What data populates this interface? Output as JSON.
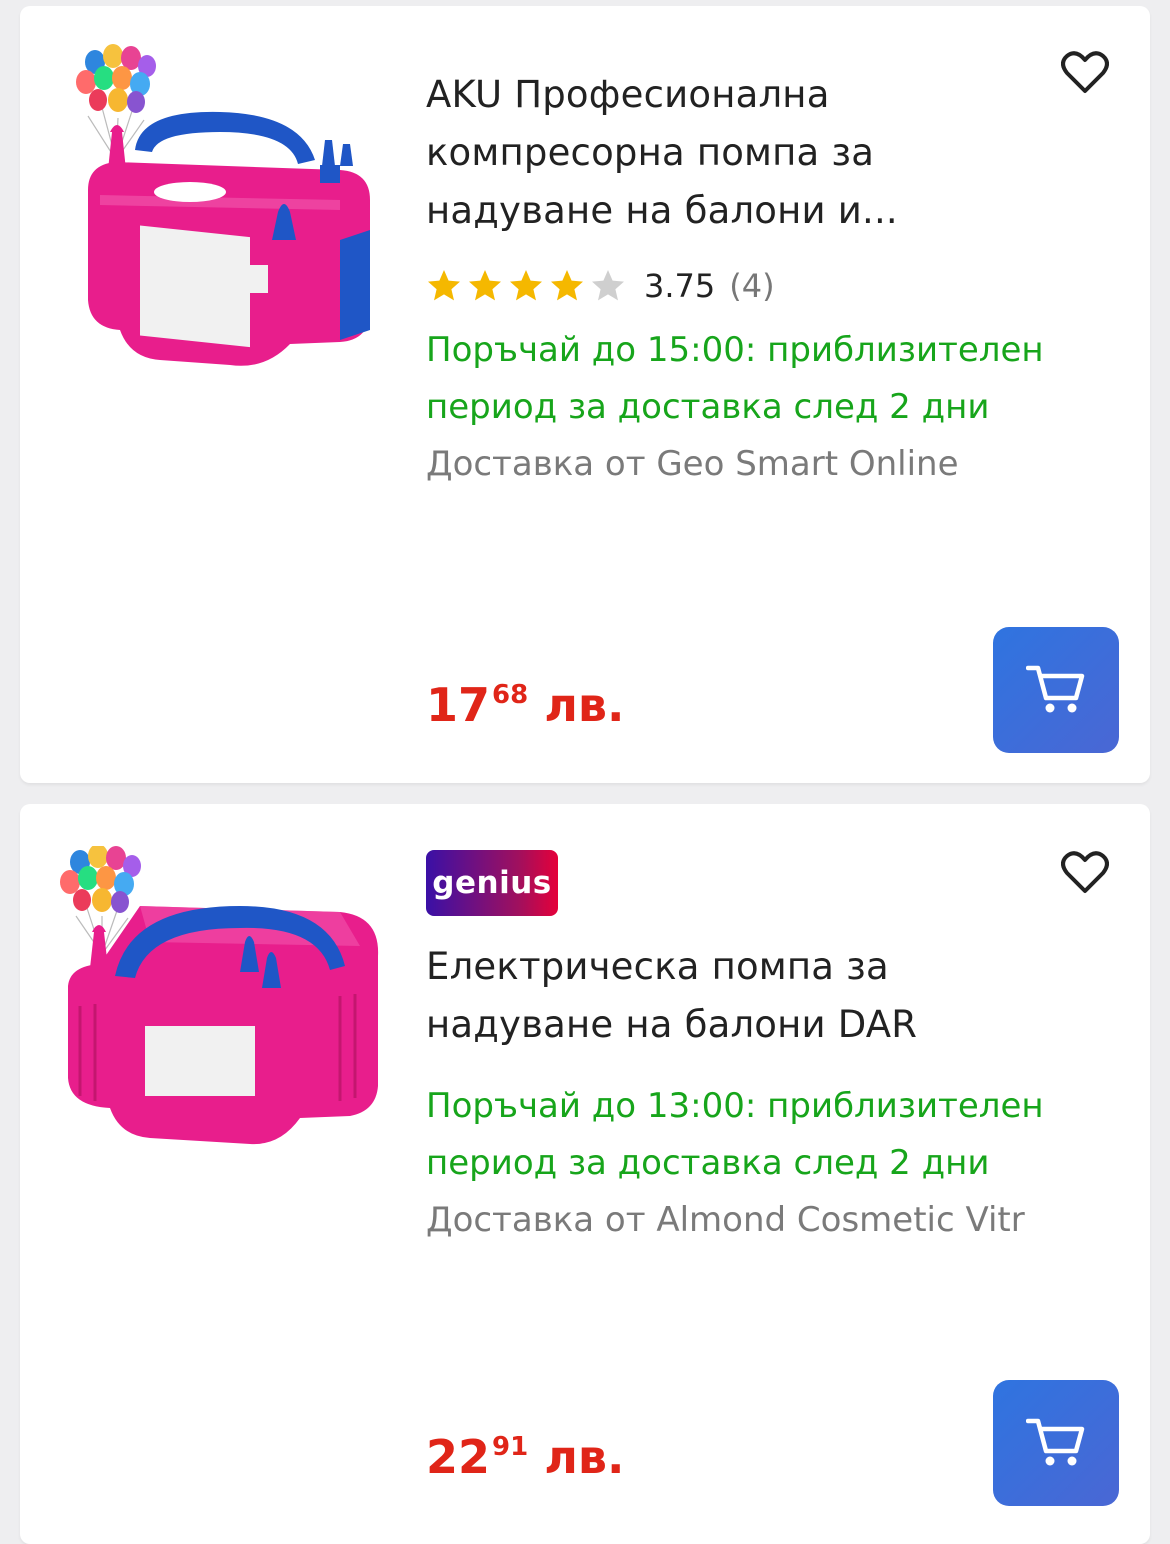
{
  "colors": {
    "price": "#e02518",
    "delivery": "#17a51b",
    "seller": "#7a7a7a",
    "cart_button": "#3b6fe0",
    "star_filled": "#f5b800",
    "star_empty": "#cfcfcf"
  },
  "products": [
    {
      "image_icon": "balloon-pump-image",
      "title": "AKU Професионална компресорна помпа за надуване на балони и...",
      "rating": 3.75,
      "rating_value": "3.75",
      "rating_count": "(4)",
      "stars_filled": 4,
      "delivery": "Поръчай до 15:00: приблизителен период за доставка след 2 дни",
      "seller": "Доставка от Geo Smart Online",
      "price_main": "17",
      "price_cents": "68",
      "price_currency": " лв.",
      "favorite_icon": "heart-outline-icon",
      "cart_icon": "cart-icon"
    },
    {
      "badge": "genius",
      "image_icon": "balloon-pump-image",
      "title": "Електрическа помпа за надуване на балони DAR",
      "delivery": "Поръчай до 13:00: приблизителен период за доставка след 2 дни",
      "seller": "Доставка от Almond Cosmetic Vitr",
      "price_main": "22",
      "price_cents": "91",
      "price_currency": " лв.",
      "favorite_icon": "heart-outline-icon",
      "cart_icon": "cart-icon"
    }
  ]
}
